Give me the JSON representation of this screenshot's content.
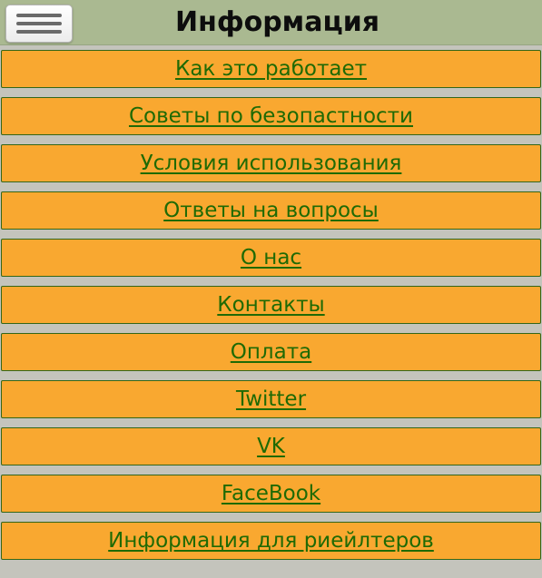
{
  "header": {
    "title": "Информация",
    "menu_icon": "hamburger-menu-icon"
  },
  "menu": {
    "items": [
      {
        "label": "Как это работает"
      },
      {
        "label": "Советы по безопастности"
      },
      {
        "label": "Условия использования"
      },
      {
        "label": "Ответы на вопросы"
      },
      {
        "label": "О нас"
      },
      {
        "label": "Контакты"
      },
      {
        "label": "Оплата"
      },
      {
        "label": "Twitter"
      },
      {
        "label": "VK"
      },
      {
        "label": "FaceBook"
      },
      {
        "label": "Информация для риейлтеров"
      }
    ]
  },
  "colors": {
    "header_bg": "#aab991",
    "page_bg": "#c4c4bc",
    "item_bg": "#f9a830",
    "item_text": "#1f6a05",
    "item_border": "#336618"
  }
}
